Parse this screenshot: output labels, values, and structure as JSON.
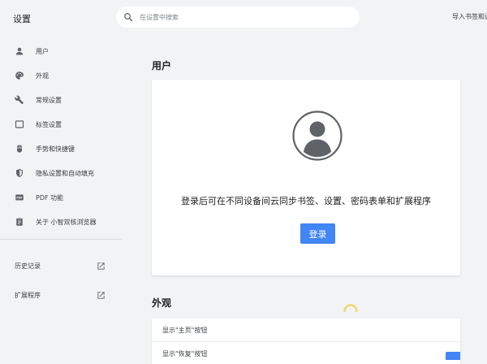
{
  "app": {
    "title": "设置"
  },
  "search": {
    "placeholder": "在设置中搜索"
  },
  "header": {
    "import_link": "导入书签和设置"
  },
  "sidebar": {
    "items": [
      {
        "label": "用户",
        "icon": "person-icon"
      },
      {
        "label": "外观",
        "icon": "palette-icon"
      },
      {
        "label": "常规设置",
        "icon": "wrench-icon"
      },
      {
        "label": "标签设置",
        "icon": "tab-icon"
      },
      {
        "label": "手势和快捷键",
        "icon": "mouse-icon"
      },
      {
        "label": "隐私设置和自动填充",
        "icon": "shield-icon"
      },
      {
        "label": "PDF 功能",
        "icon": "pdf-icon"
      },
      {
        "label": "关于 小智双核浏览器",
        "icon": "clipboard-icon"
      }
    ],
    "external": [
      {
        "label": "历史记录",
        "icon": "open-in-new-icon"
      },
      {
        "label": "扩展程序",
        "icon": "open-in-new-icon"
      }
    ]
  },
  "main": {
    "user_section": {
      "title": "用户",
      "signin_message": "登录后可在不同设备间云同步书签、设置、密码表单和扩展程序",
      "login_label": "登录"
    },
    "appearance_section": {
      "title": "外观",
      "rows": [
        {
          "label": "显示\"主页\"按钮"
        },
        {
          "label": "显示\"恢复\"按钮"
        }
      ]
    }
  },
  "colors": {
    "accent": "#4285f4",
    "background": "#f1f3f4",
    "card": "#ffffff",
    "icon": "#5f6368"
  }
}
